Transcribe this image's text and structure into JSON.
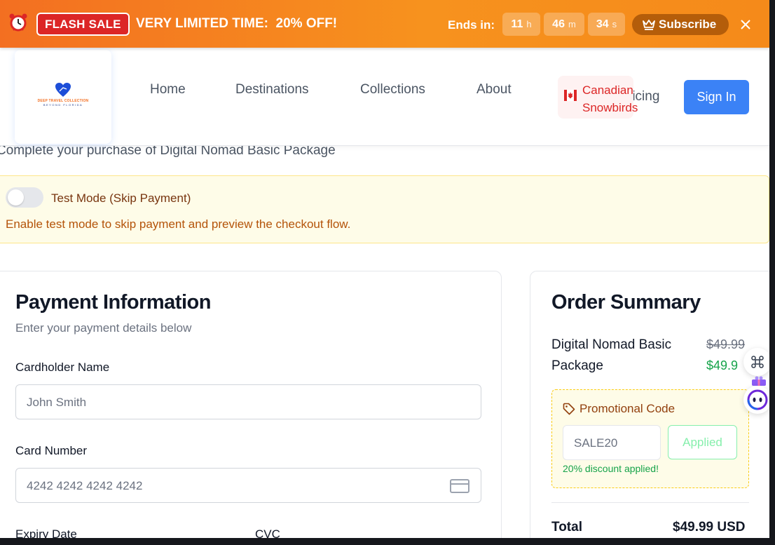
{
  "banner": {
    "badge": "FLASH SALE",
    "promo": "VERY LIMITED TIME:  20% OFF!",
    "ends_label": "Ends in:",
    "timer": {
      "hours": "11",
      "h": "h",
      "minutes": "46",
      "m": "m",
      "seconds": "34",
      "s": "s"
    },
    "subscribe": "Subscribe",
    "colors": {
      "gradient_start": "#f36f21",
      "badge": "#dc2626"
    }
  },
  "nav": {
    "logo_line1": "DEEP TRAVEL COLLECTION",
    "logo_line2": "BEYOND FLORIDA",
    "links": [
      "Home",
      "Destinations",
      "Collections",
      "About"
    ],
    "canadian": "Canadian Snowbirds",
    "pricing": "ricing",
    "sign_in": "Sign In"
  },
  "page": {
    "subtitle": "Complete your purchase of Digital Nomad Basic Package",
    "test_mode_label": "Test Mode (Skip Payment)",
    "test_mode_desc": "Enable test mode to skip payment and preview the checkout flow."
  },
  "payment": {
    "title": "Payment Information",
    "subtitle": "Enter your payment details below",
    "cardholder_label": "Cardholder Name",
    "cardholder_placeholder": "John Smith",
    "card_number_label": "Card Number",
    "card_number_placeholder": "4242 4242 4242 4242",
    "expiry_label": "Expiry Date",
    "cvc_label": "CVC"
  },
  "summary": {
    "title": "Order Summary",
    "item_name": "Digital Nomad Basic Package",
    "price_original": "$49.99",
    "price_discounted": "$49.9",
    "promo_heading": "Promotional Code",
    "promo_code": "SALE20",
    "applied_label": "Applied",
    "promo_message": "20% discount applied!",
    "total_label": "Total",
    "total_value": "$49.99 USD"
  },
  "icons": [
    "alarm-clock-icon",
    "crown-icon",
    "close-icon",
    "canada-flag-icon",
    "credit-card-icon",
    "tag-icon",
    "command-icon",
    "gift-icon",
    "chat-bot-icon"
  ]
}
